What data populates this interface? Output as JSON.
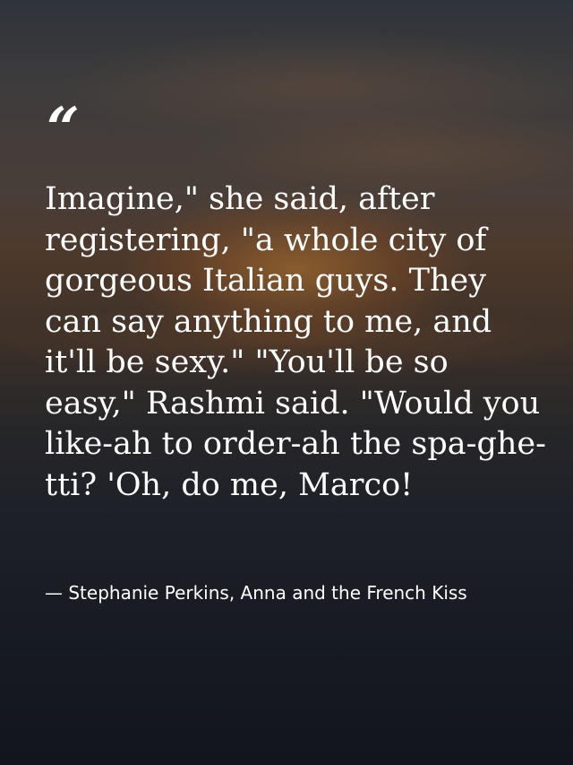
{
  "quote": {
    "mark": "“",
    "text": "Imagine,\" she said, after registering, \"a whole city of gorgeous Italian guys. They can say anything to me, and it'll be sexy.\" \"You'll be so easy,\" Rashmi said. \"Would you like-ah to order-ah the spa-ghe-tti? 'Oh, do me, Marco!",
    "attribution": "— Stephanie Perkins, Anna and the French Kiss"
  }
}
